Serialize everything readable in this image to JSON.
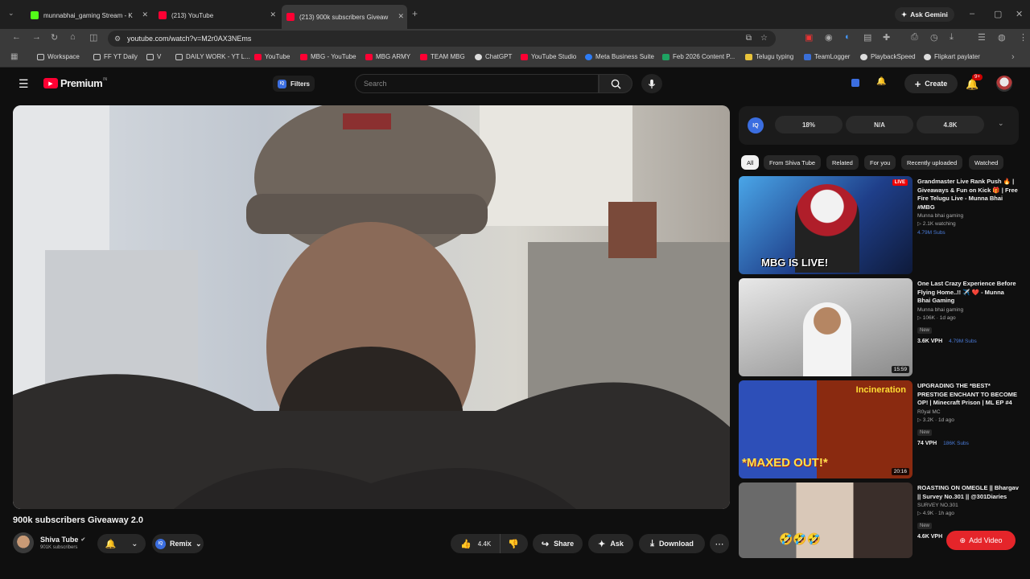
{
  "tabs": [
    {
      "title": "munnabhai_gaming Stream - K",
      "active": false
    },
    {
      "title": "(213) YouTube",
      "active": false
    },
    {
      "title": "(213) 900k subscribers Giveaw",
      "active": true
    }
  ],
  "ask_gemini": "Ask Gemini",
  "url": "youtube.com/watch?v=M2r0AX3NEms",
  "bookmarks": [
    "Workspace",
    "FF YT Daily",
    "V",
    "DAILY WORK - YT L...",
    "YouTube",
    "MBG - YouTube",
    "MBG ARMY",
    "TEAM MBG",
    "ChatGPT",
    "YouTube Studio",
    "Meta Business Suite",
    "Feb 2026 Content P...",
    "Telugu typing",
    "TeamLogger",
    "PlaybackSpeed",
    "Flipkart paylater"
  ],
  "header": {
    "logo_text": "Premium",
    "logo_sup": "IN",
    "filters_label": "Filters",
    "search_placeholder": "Search",
    "create_label": "Create",
    "notif_badge": "9+"
  },
  "video": {
    "title": "900k subscribers Giveaway 2.0",
    "channel": "Shiva Tube",
    "subscribers": "901K subscribers",
    "remix_label": "Remix",
    "likes": "4.4K",
    "share_label": "Share",
    "ask_label": "Ask",
    "download_label": "Download"
  },
  "iq": {
    "stats": [
      "18%",
      "N/A",
      "4.8K"
    ]
  },
  "chips": [
    "All",
    "From Shiva Tube",
    "Related",
    "For you",
    "Recently uploaded",
    "Watched"
  ],
  "recommendations": [
    {
      "title": "Grandmaster Live Rank Push 🔥 | Giveaways & Fun on Kick 🎁 | Free Fire Telugu Live - Munna Bhai #MBG",
      "channel": "Munna bhai gaming",
      "meta": "▷ 2.1K watching",
      "badge": "",
      "vph": "",
      "subs": "4.79M Subs",
      "duration": "LIVE",
      "thumb_text": "MBG IS LIVE!"
    },
    {
      "title": "One Last Crazy Experience Before Flying Home..!! ✈️ ❤️ - Munna Bhai Gaming",
      "channel": "Munna bhai gaming",
      "meta": "▷ 106K · 1d ago",
      "badge": "New",
      "vph": "3.6K VPH",
      "subs": "4.79M Subs",
      "duration": "15:59",
      "thumb_text": ""
    },
    {
      "title": "UPGRADING THE *BEST* PRESTIGE ENCHANT TO BECOME OP! | Minecraft Prison | ML EP #4",
      "channel": "R0yal MC",
      "meta": "▷ 3.2K · 1d ago",
      "badge": "New",
      "vph": "74 VPH",
      "subs": "186K Subs",
      "duration": "20:16",
      "thumb_text": "*MAXED OUT!*",
      "thumb_text2": "Incineration"
    },
    {
      "title": "ROASTING ON OMEGLE || Bhargav || Survey No.301 || @301Diaries",
      "channel": "SURVEY NO.301",
      "meta": "▷ 4.9K · 1h ago",
      "badge": "New",
      "vph": "4.6K VPH",
      "subs": "",
      "duration": "",
      "thumb_text": "🤣🤣🤣"
    }
  ],
  "add_video": "Add Video"
}
